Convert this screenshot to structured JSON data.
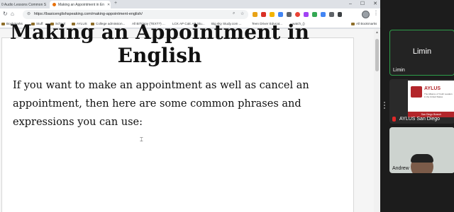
{
  "browser": {
    "tabs": [
      {
        "label": "0 Audio Lessons Common S",
        "active": false
      },
      {
        "label": "Making an Appointment in En",
        "active": true
      }
    ],
    "new_tab_glyph": "+",
    "window_controls": [
      "–",
      "☐",
      "✕"
    ],
    "url": "https://basicenglishspeaking.com/making-appointment-english/",
    "bookmarks": [
      {
        "label": "Bookmarks",
        "icon": "folder-icon"
      },
      {
        "label": "Stuff",
        "icon": "folder-icon"
      },
      {
        "label": "School",
        "icon": "folder-icon"
      },
      {
        "label": "AYLUS",
        "icon": "folder-icon"
      },
      {
        "label": "College admission...",
        "icon": "folder-icon"
      },
      {
        "label": "All BiTrippy (TEXT?) ...",
        "icon": "page-icon"
      },
      {
        "label": "LCK AP Calc AB Stu...",
        "icon": "page-icon"
      },
      {
        "label": "Big sky Study.com ...",
        "icon": "page-icon"
      },
      {
        "label": "Teen Driver Educat...",
        "icon": "page-icon"
      },
      {
        "label": "watch_()",
        "icon": "page-icon"
      },
      {
        "label": "All Bookmarks",
        "icon": "folder-icon"
      }
    ],
    "extension_colors": [
      "#e8a317",
      "#d93025",
      "#f4b400",
      "#4285f4",
      "#5f6368",
      "#ea4335",
      "#a142f4",
      "#34a853",
      "#4285f4"
    ]
  },
  "article": {
    "title": "Making an Appointment in English",
    "body": "If you want to make an appointment as well as cancel an appointment, then here are some common phrases and expressions you can use:"
  },
  "meeting": {
    "participants": [
      {
        "name": "Limin",
        "display": "Limin",
        "active_speaker": true
      },
      {
        "name": "AYLUS San Diego",
        "slide_logo": "AYLUS",
        "slide_sub": "The Alliance of Youth Leaders in the United States",
        "slide_banner": "San Diego Branch",
        "muted": true
      },
      {
        "name": "Andrew"
      }
    ]
  },
  "colors": {
    "active_speaker_border": "#2e9e4a",
    "aylus_red": "#b3262b",
    "mute_red": "#e02828"
  }
}
